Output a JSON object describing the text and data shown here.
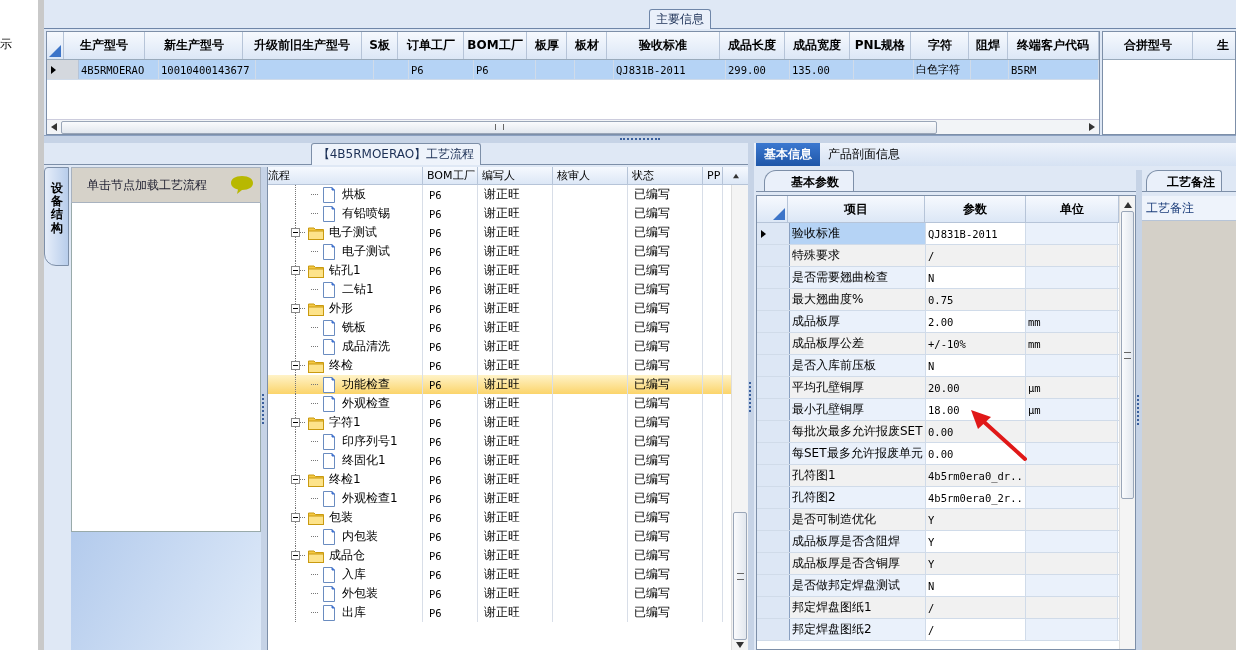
{
  "left_strip": {
    "text": "示"
  },
  "main_info": {
    "title": "主要信息",
    "columns": [
      "生产型号",
      "新生产型号",
      "升级前旧生产型号",
      "S板",
      "订单工厂",
      "BOM工厂",
      "板厚",
      "板材",
      "验收标准",
      "成品长度",
      "成品宽度",
      "PNL规格",
      "字符",
      "阻焊",
      "终端客户代码"
    ],
    "rows": [
      {
        "selected": true,
        "cells": [
          "4B5RMOERAO",
          "10010400143677",
          null,
          null,
          "P6",
          "P6",
          null,
          null,
          "QJ831B-2011",
          "299.00",
          "135.00",
          null,
          "白色字符",
          null,
          "B5RM"
        ]
      }
    ],
    "side_columns": [
      "合拼型号",
      "生"
    ]
  },
  "process": {
    "title": "【4B5RMOERAO】工艺流程",
    "side_tab": "设备结构",
    "hint": "单击节点加载工艺流程",
    "columns": [
      "流程",
      "BOM工厂",
      "编写人",
      "核审人",
      "状态",
      "PP"
    ],
    "tree": [
      {
        "children": [
          {
            "label": "烘板",
            "bom": "P6",
            "author": "谢正旺",
            "status": "已编写",
            "selected": false
          },
          {
            "label": "有铅喷锡",
            "bom": "P6",
            "author": "谢正旺",
            "status": "已编写",
            "selected": false
          }
        ]
      },
      {
        "label": "电子测试",
        "bom": "P6",
        "author": "谢正旺",
        "status": "已编写",
        "selected": false,
        "expanded": true,
        "children": [
          {
            "label": "电子测试",
            "bom": "P6",
            "author": "谢正旺",
            "status": "已编写",
            "selected": false
          }
        ]
      },
      {
        "label": "钻孔1",
        "bom": "P6",
        "author": "谢正旺",
        "status": "已编写",
        "selected": false,
        "expanded": true,
        "children": [
          {
            "label": "二钻1",
            "bom": "P6",
            "author": "谢正旺",
            "status": "已编写",
            "selected": false
          }
        ]
      },
      {
        "label": "外形",
        "bom": "P6",
        "author": "谢正旺",
        "status": "已编写",
        "selected": false,
        "expanded": true,
        "children": [
          {
            "label": "铣板",
            "bom": "P6",
            "author": "谢正旺",
            "status": "已编写",
            "selected": false
          },
          {
            "label": "成品清洗",
            "bom": "P6",
            "author": "谢正旺",
            "status": "已编写",
            "selected": false
          }
        ]
      },
      {
        "label": "终检",
        "bom": "P6",
        "author": "谢正旺",
        "status": "已编写",
        "selected": false,
        "expanded": true,
        "children": [
          {
            "label": "功能检查",
            "bom": "P6",
            "author": "谢正旺",
            "status": "已编写",
            "selected": true
          },
          {
            "label": "外观检查",
            "bom": "P6",
            "author": "谢正旺",
            "status": "已编写",
            "selected": false
          }
        ]
      },
      {
        "label": "字符1",
        "bom": "P6",
        "author": "谢正旺",
        "status": "已编写",
        "selected": false,
        "expanded": true,
        "children": [
          {
            "label": "印序列号1",
            "bom": "P6",
            "author": "谢正旺",
            "status": "已编写",
            "selected": false
          },
          {
            "label": "终固化1",
            "bom": "P6",
            "author": "谢正旺",
            "status": "已编写",
            "selected": false
          }
        ]
      },
      {
        "label": "终检1",
        "bom": "P6",
        "author": "谢正旺",
        "status": "已编写",
        "selected": false,
        "expanded": true,
        "children": [
          {
            "label": "外观检查1",
            "bom": "P6",
            "author": "谢正旺",
            "status": "已编写",
            "selected": false
          }
        ]
      },
      {
        "label": "包装",
        "bom": "P6",
        "author": "谢正旺",
        "status": "已编写",
        "selected": false,
        "expanded": true,
        "children": [
          {
            "label": "内包装",
            "bom": "P6",
            "author": "谢正旺",
            "status": "已编写",
            "selected": false
          }
        ]
      },
      {
        "label": "成品仓",
        "bom": "P6",
        "author": "谢正旺",
        "status": "已编写",
        "selected": false,
        "expanded": true,
        "children": [
          {
            "label": "入库",
            "bom": "P6",
            "author": "谢正旺",
            "status": "已编写",
            "selected": false
          },
          {
            "label": "外包装",
            "bom": "P6",
            "author": "谢正旺",
            "status": "已编写",
            "selected": false
          },
          {
            "label": "出库",
            "bom": "P6",
            "author": "谢正旺",
            "status": "已编写",
            "selected": false
          }
        ]
      }
    ]
  },
  "detail": {
    "tabs": [
      {
        "label": "基本信息",
        "selected": true
      },
      {
        "label": "产品剖面信息",
        "selected": false
      }
    ],
    "params_tab": "基本参数",
    "columns": [
      "项目",
      "参数",
      "单位"
    ],
    "params": [
      {
        "item": "验收标准",
        "value": "QJ831B-2011",
        "selected": true
      },
      {
        "item": "特殊要求",
        "value": "/",
        "selected": false
      },
      {
        "item": "是否需要翘曲检查",
        "value": "N",
        "selected": false
      },
      {
        "item": "最大翘曲度%",
        "value": "0.75",
        "selected": false
      },
      {
        "item": "成品板厚",
        "value": "2.00",
        "unit": "mm",
        "selected": false
      },
      {
        "item": "成品板厚公差",
        "value": "+/-10%",
        "unit": "mm",
        "selected": false
      },
      {
        "item": "是否入库前压板",
        "value": "N",
        "selected": false
      },
      {
        "item": "平均孔壁铜厚",
        "value": "20.00",
        "unit": "μm",
        "selected": false
      },
      {
        "item": "最小孔壁铜厚",
        "value": "18.00",
        "unit": "μm",
        "selected": false
      },
      {
        "item": "每批次最多允许报废SET",
        "value": "0.00",
        "selected": false
      },
      {
        "item": "每SET最多允许报废单元",
        "value": "0.00",
        "selected": false
      },
      {
        "item": "孔符图1",
        "value": "4b5rm0era0_dr...",
        "selected": false
      },
      {
        "item": "孔符图2",
        "value": "4b5rm0era0_2r...",
        "selected": false
      },
      {
        "item": "是否可制造优化",
        "value": "Y",
        "selected": false
      },
      {
        "item": "成品板厚是否含阻焊",
        "value": "Y",
        "selected": false
      },
      {
        "item": "成品板厚是否含铜厚",
        "value": "Y",
        "selected": false
      },
      {
        "item": "是否做邦定焊盘测试",
        "value": "N",
        "selected": false
      },
      {
        "item": "邦定焊盘图纸1",
        "value": "/",
        "selected": false
      },
      {
        "item": "邦定焊盘图纸2",
        "value": "/",
        "selected": false
      }
    ],
    "remarks_tab": "工艺备注",
    "remarks_label": "工艺备注"
  }
}
